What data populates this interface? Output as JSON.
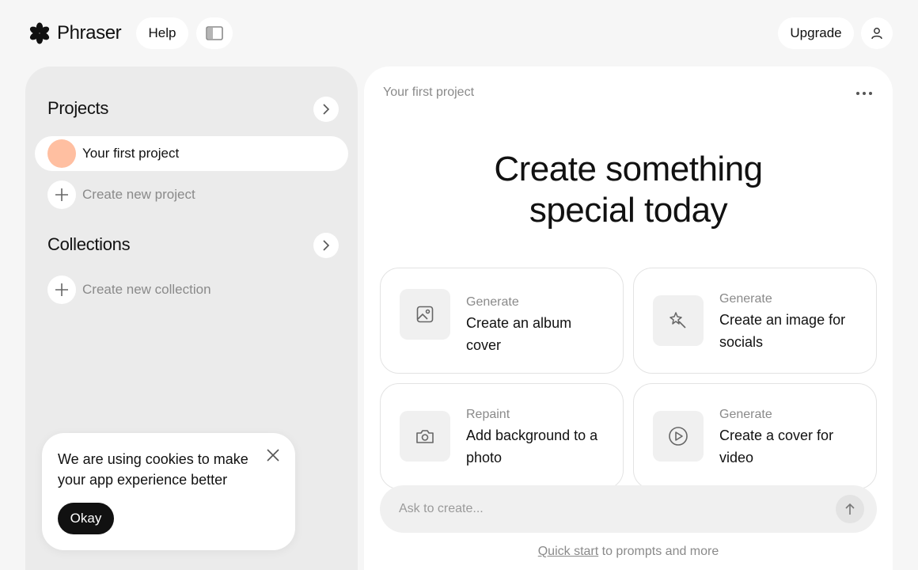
{
  "header": {
    "brand": "Phraser",
    "help_label": "Help",
    "upgrade_label": "Upgrade"
  },
  "sidebar": {
    "projects_title": "Projects",
    "projects": [
      {
        "label": "Your first project",
        "avatar_color": "#ffbfa1"
      }
    ],
    "create_project_label": "Create new project",
    "collections_title": "Collections",
    "create_collection_label": "Create new collection"
  },
  "cookie": {
    "message": "We are using cookies to make your app experience better",
    "okay_label": "Okay"
  },
  "main": {
    "project_title": "Your first project",
    "hero_line1": "Create something",
    "hero_line2": "special today",
    "cards": [
      {
        "kicker": "Generate",
        "label": "Create an album cover",
        "icon": "image-icon"
      },
      {
        "kicker": "Generate",
        "label": "Create an image for socials",
        "icon": "magic-wand-icon"
      },
      {
        "kicker": "Repaint",
        "label": "Add background to a photo",
        "icon": "camera-icon"
      },
      {
        "kicker": "Generate",
        "label": "Create a cover for video",
        "icon": "play-icon"
      }
    ],
    "prompt_placeholder": "Ask to create...",
    "quick_start_link": "Quick start",
    "quick_start_rest": " to prompts and more"
  },
  "colors": {
    "background": "#f6f6f6",
    "sidebar": "#ebebeb",
    "accent_dark": "#111111",
    "avatar": "#ffbfa1"
  }
}
